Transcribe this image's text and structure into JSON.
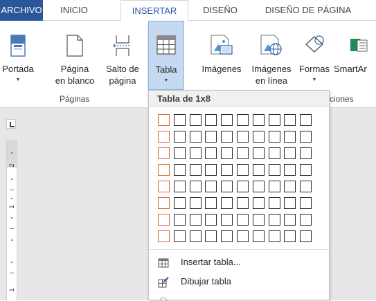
{
  "tabs": [
    {
      "label": "ARCHIVO",
      "state": "file"
    },
    {
      "label": "INICIO",
      "state": "normal"
    },
    {
      "label": "INSERTAR",
      "state": "active"
    },
    {
      "label": "DISEÑO",
      "state": "normal"
    },
    {
      "label": "DISEÑO DE PÁGINA",
      "state": "normal"
    }
  ],
  "ribbon": {
    "buttons": [
      {
        "line1": "Portada",
        "line2": "",
        "dropdown": true,
        "icon": "cover-page-icon"
      },
      {
        "line1": "Página",
        "line2": "en blanco",
        "dropdown": false,
        "icon": "blank-page-icon"
      },
      {
        "line1": "Salto de",
        "line2": "página",
        "dropdown": false,
        "icon": "page-break-icon"
      },
      {
        "line1": "Tabla",
        "line2": "",
        "dropdown": true,
        "icon": "table-icon",
        "pressed": true
      },
      {
        "line1": "Imágenes",
        "line2": "",
        "dropdown": false,
        "icon": "pictures-icon"
      },
      {
        "line1": "Imágenes",
        "line2": "en línea",
        "dropdown": false,
        "icon": "online-pictures-icon"
      },
      {
        "line1": "Formas",
        "line2": "",
        "dropdown": true,
        "icon": "shapes-icon"
      },
      {
        "line1": "SmartAr",
        "line2": "",
        "dropdown": false,
        "icon": "smartart-icon"
      }
    ],
    "groups": [
      {
        "label": "Páginas"
      },
      {
        "label": "ciones"
      }
    ]
  },
  "ruler": {
    "numbers": [
      "2",
      "1",
      "1"
    ]
  },
  "table_menu": {
    "title": "Tabla de 1x8",
    "grid_columns": 10,
    "grid_rows": 8,
    "selected_columns": 1,
    "selected_rows": 8,
    "items": [
      {
        "label": "Insertar tabla...",
        "icon": "insert-table-icon"
      },
      {
        "label": "Dibujar tabla",
        "icon": "draw-table-icon"
      }
    ]
  },
  "colors": {
    "file_tab": "#2b579a",
    "active_tab_text": "#2b579a",
    "pressed_button": "#c5daf0",
    "grid_highlight": "#d9683a"
  }
}
